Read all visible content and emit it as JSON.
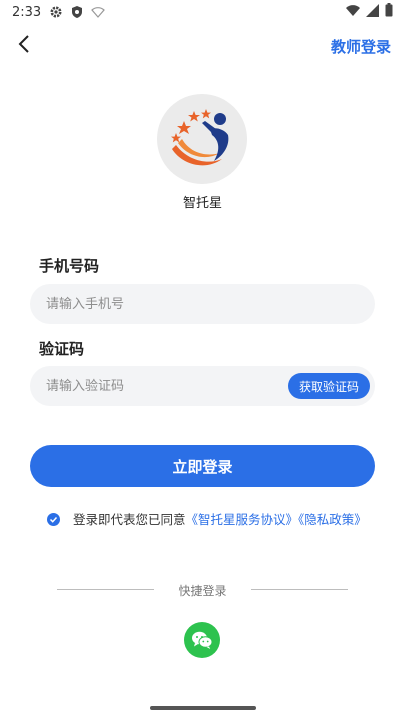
{
  "status_bar": {
    "time": "2:33",
    "icons_left": [
      "gear-icon",
      "shield-icon",
      "wifi-outline-icon"
    ],
    "icons_right": [
      "wifi-icon",
      "signal-icon",
      "battery-icon"
    ]
  },
  "nav": {
    "back_icon": "chevron-left-icon",
    "teacher_login": "教师登录"
  },
  "app": {
    "name": "智托星"
  },
  "form": {
    "phone_label": "手机号码",
    "phone_placeholder": "请输入手机号",
    "phone_value": "",
    "code_label": "验证码",
    "code_placeholder": "请输入验证码",
    "code_value": "",
    "get_code": "获取验证码",
    "login": "立即登录"
  },
  "agreement": {
    "checked": true,
    "prefix": "登录即代表您已同意",
    "service": "《智托星服务协议》",
    "privacy": "《隐私政策》"
  },
  "quick_login": {
    "label": "快捷登录",
    "wechat_icon": "wechat-icon"
  },
  "colors": {
    "accent": "#2b6fe6",
    "wechat": "#2dc24e",
    "field_bg": "#f3f4f6"
  }
}
